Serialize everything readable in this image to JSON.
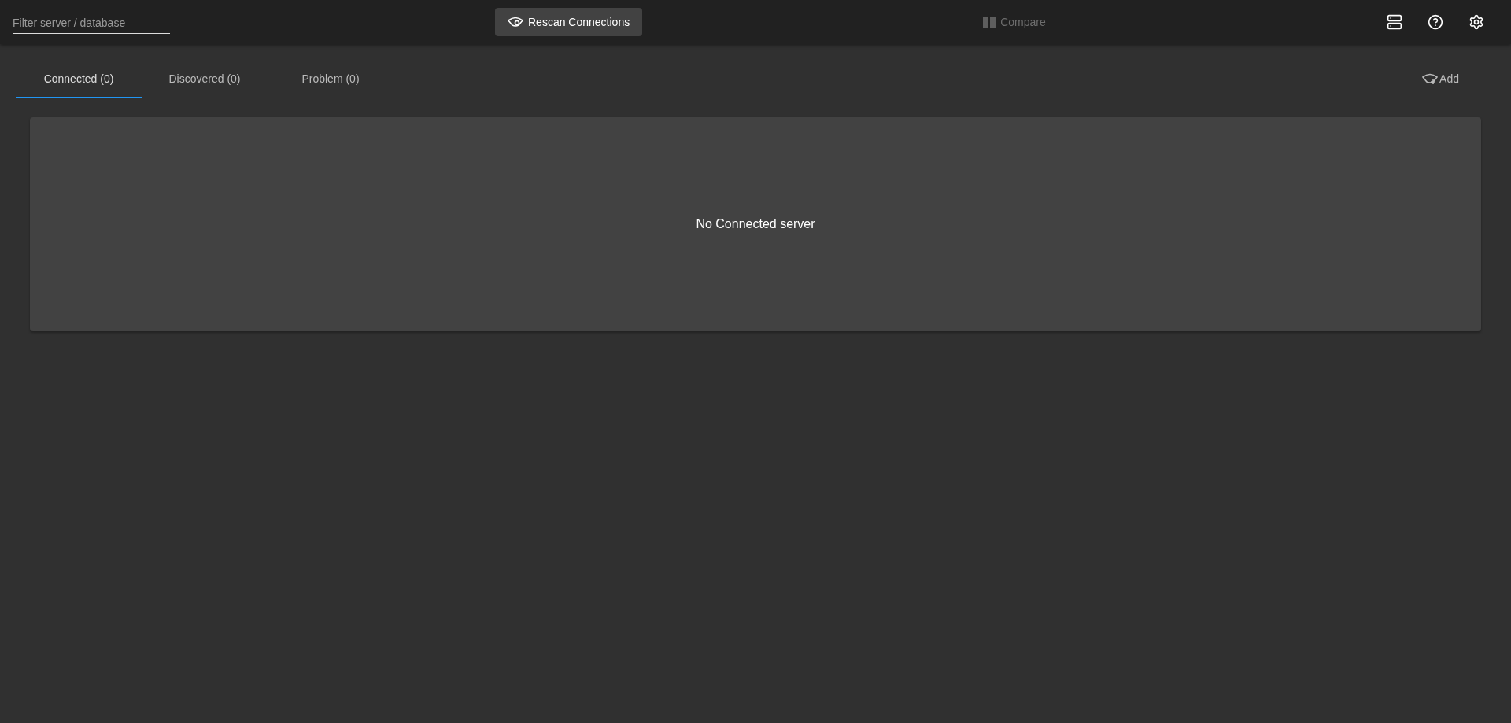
{
  "toolbar": {
    "filter": {
      "placeholder": "Filter server / database"
    },
    "rescan": {
      "label": "Rescan Connections"
    },
    "compare": {
      "label": "Compare",
      "disabled": true
    }
  },
  "tabs": [
    {
      "label": "Connected (0)",
      "selected": true
    },
    {
      "label": "Discovered (0)",
      "selected": false
    },
    {
      "label": "Problem (0)",
      "selected": false
    }
  ],
  "add": {
    "label": "Add"
  },
  "panel": {
    "message": "No Connected server"
  }
}
